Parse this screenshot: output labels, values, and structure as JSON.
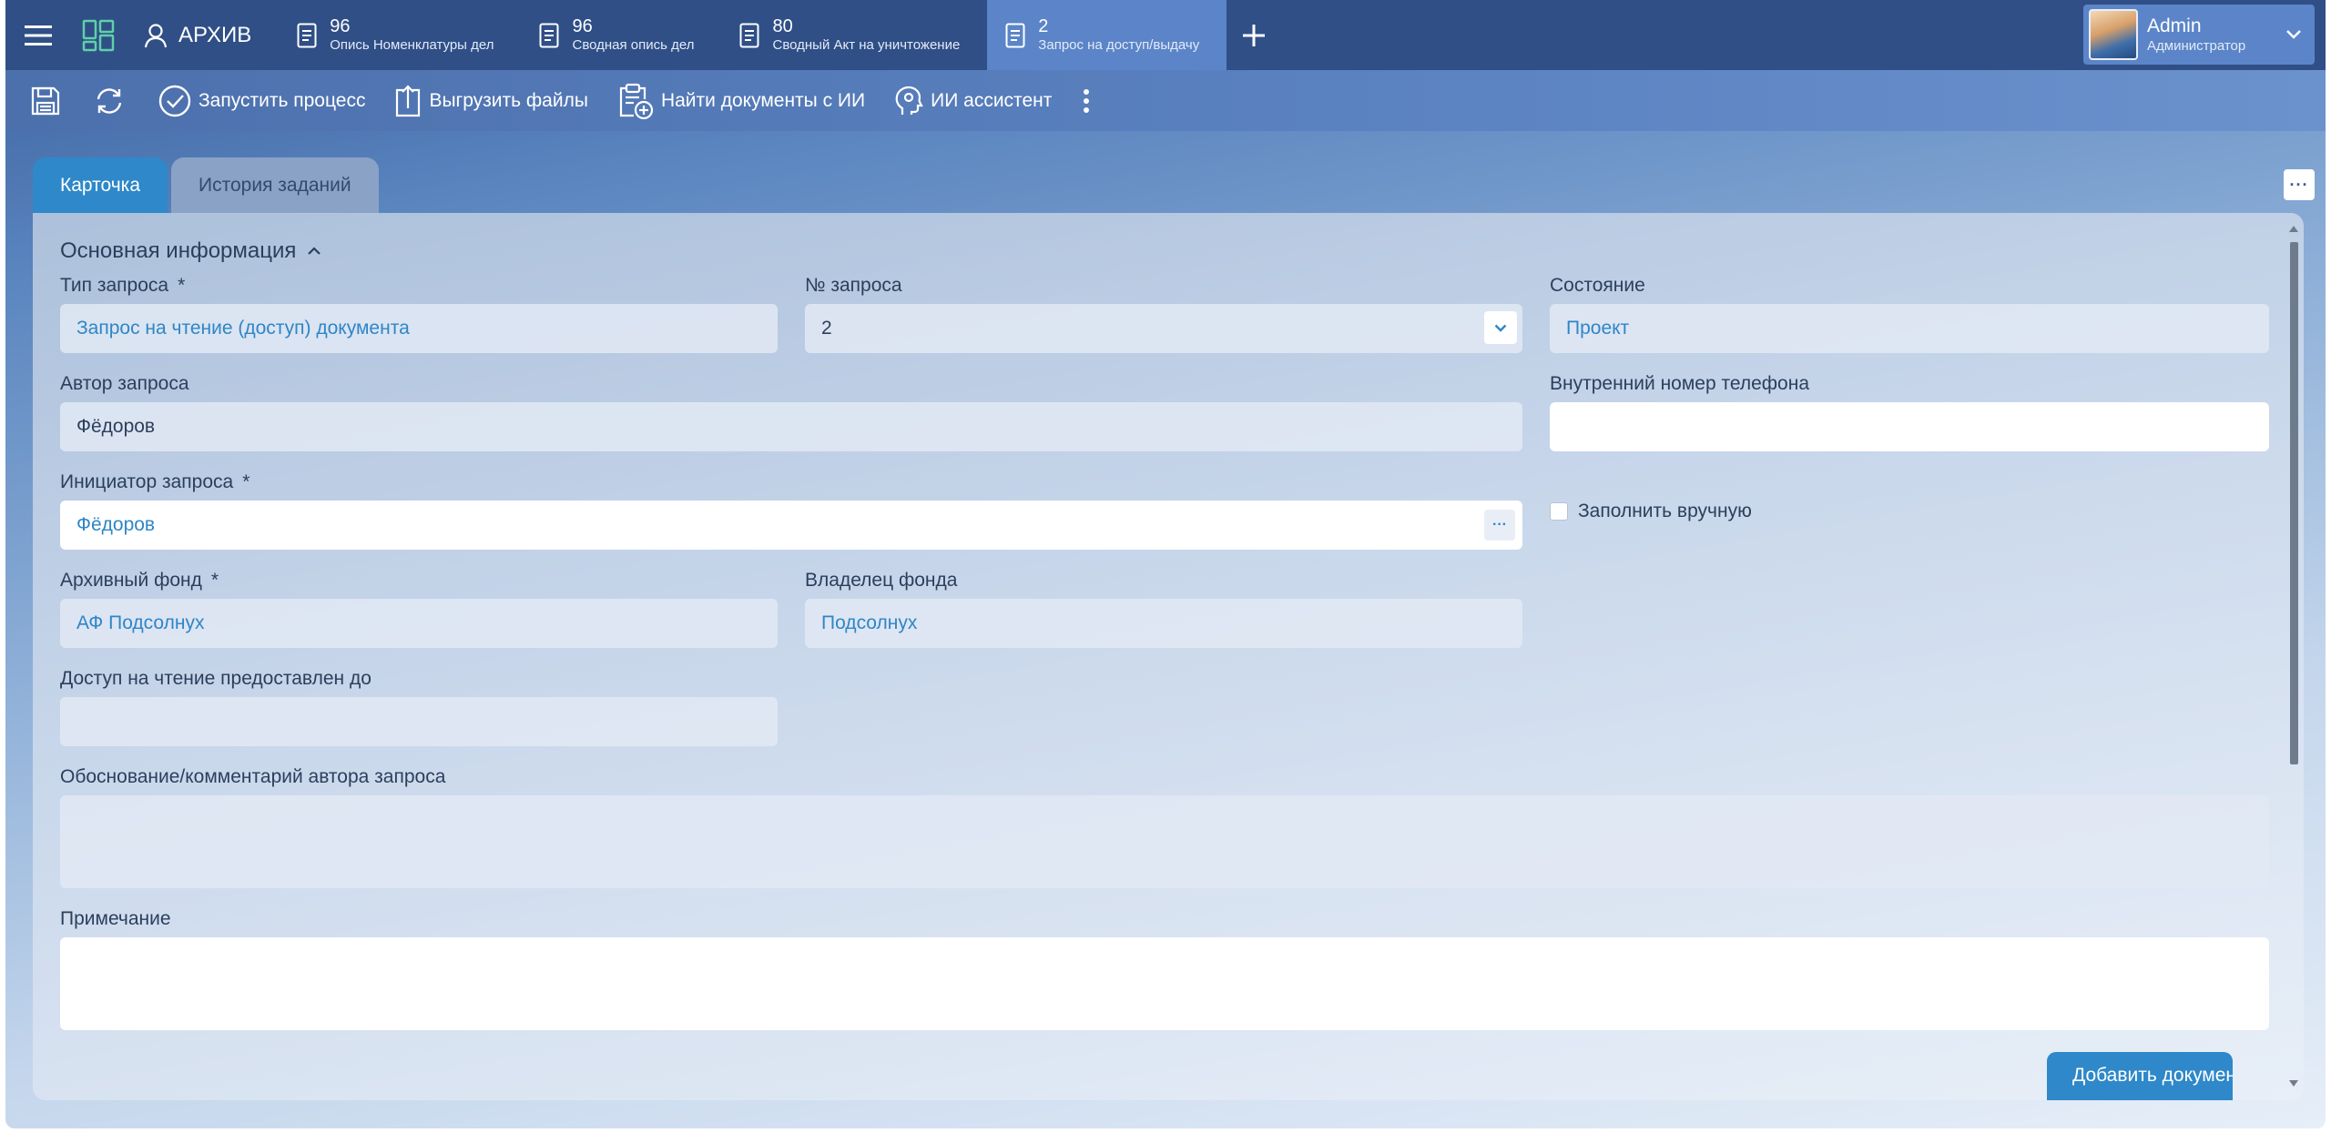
{
  "topbar": {
    "archive_label": "АРХИВ",
    "tabs": [
      {
        "number": "96",
        "subtitle": "Опись Номенклатуры дел"
      },
      {
        "number": "96",
        "subtitle": "Сводная опись дел"
      },
      {
        "number": "80",
        "subtitle": "Сводный Акт на уничтожение"
      },
      {
        "number": "2",
        "subtitle": "Запрос на доступ/выдачу"
      }
    ],
    "user": {
      "name": "Admin",
      "role": "Администратор"
    }
  },
  "toolbar": {
    "start_process": "Запустить процесс",
    "upload_files": "Выгрузить файлы",
    "find_ai": "Найти документы с ИИ",
    "ai_assistant": "ИИ ассистент"
  },
  "content_tabs": {
    "card": "Карточка",
    "history": "История заданий",
    "more": "···"
  },
  "form": {
    "section_title": "Основная информация",
    "request_type": {
      "label": "Тип запроса",
      "required": "*",
      "value": "Запрос на чтение (доступ) документа"
    },
    "request_number": {
      "label": "№ запроса",
      "value": "2"
    },
    "state": {
      "label": "Состояние",
      "value": "Проект"
    },
    "author": {
      "label": "Автор запроса",
      "value": "Фёдоров"
    },
    "phone": {
      "label": "Внутренний номер телефона",
      "value": ""
    },
    "initiator": {
      "label": "Инициатор запроса",
      "required": "*",
      "value": "Фёдоров",
      "button": "···"
    },
    "manual_fill": {
      "label": "Заполнить вручную",
      "checked": false
    },
    "archive_fund": {
      "label": "Архивный фонд",
      "required": "*",
      "value": "АФ Подсолнух"
    },
    "fund_owner": {
      "label": "Владелец фонда",
      "value": "Подсолнух"
    },
    "access_until": {
      "label": "Доступ на чтение предоставлен до",
      "value": ""
    },
    "justification": {
      "label": "Обоснование/комментарий автора запроса",
      "value": ""
    },
    "note": {
      "label": "Примечание",
      "value": ""
    },
    "add_document_button": "Добавить документ"
  },
  "colors": {
    "topbar": "#2f4f86",
    "active_tab": "#5b85c8",
    "accent": "#2e88c9",
    "link": "#2f86c6"
  }
}
